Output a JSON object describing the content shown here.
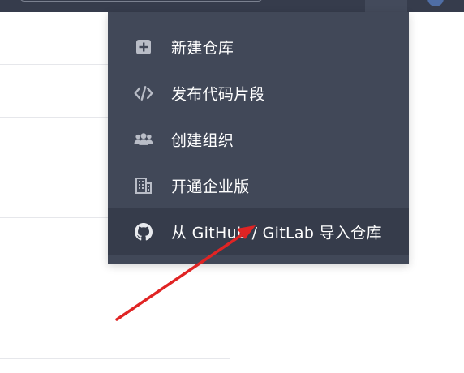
{
  "menu": {
    "items": [
      {
        "label": "新建仓库",
        "icon": "plus-square-icon"
      },
      {
        "label": "发布代码片段",
        "icon": "code-icon"
      },
      {
        "label": "创建组织",
        "icon": "users-icon"
      },
      {
        "label": "开通企业版",
        "icon": "building-icon"
      },
      {
        "label": "从 GitHub / GitLab 导入仓库",
        "icon": "github-icon"
      }
    ]
  },
  "colors": {
    "menu_background": "#414858",
    "menu_active": "#363c4b",
    "navbar": "#363c4c",
    "icon": "#b9bdc7",
    "annotation_arrow": "#e02424"
  }
}
